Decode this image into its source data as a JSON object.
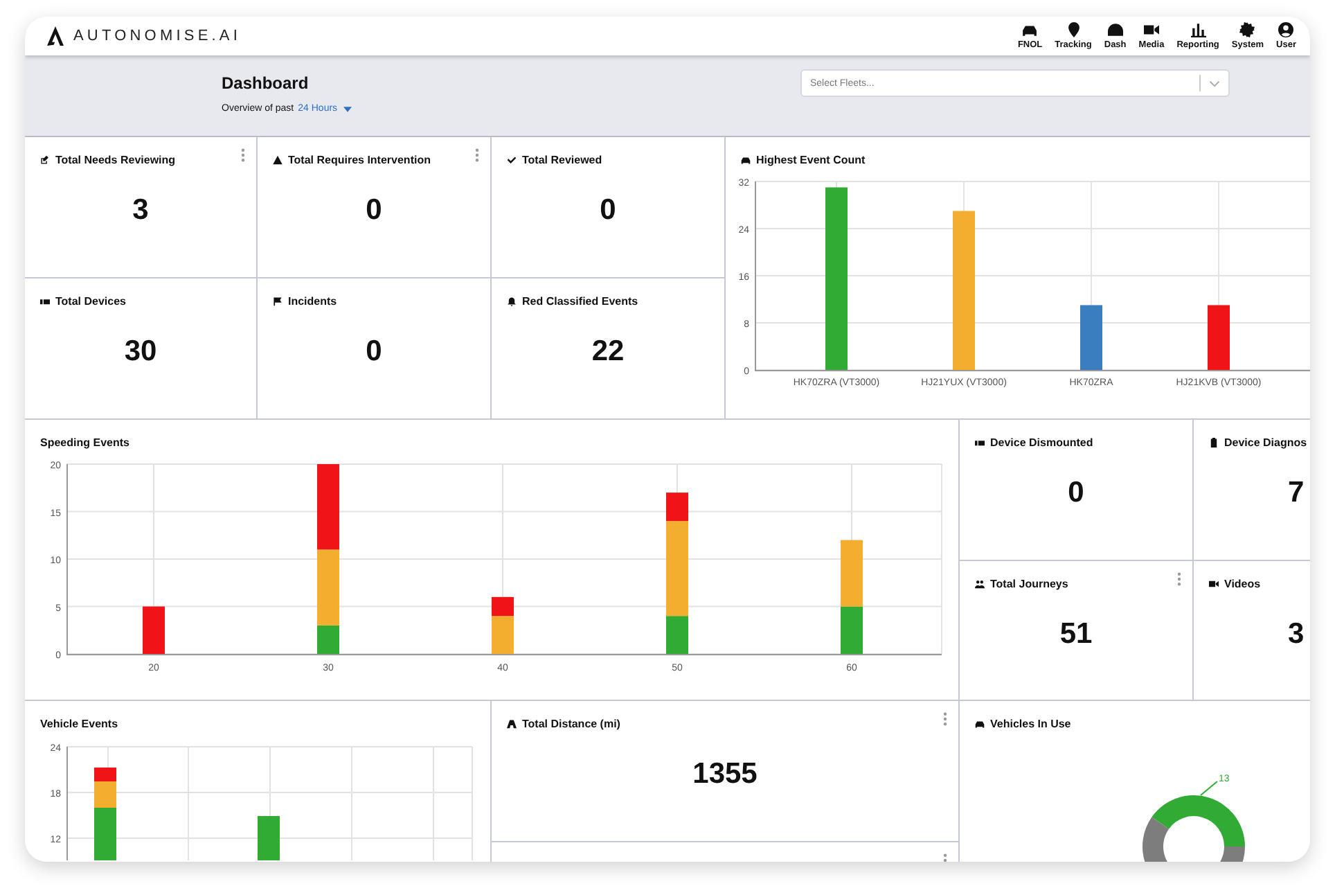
{
  "header": {
    "logo_text": "AUTONOMISE.AI",
    "nav": [
      {
        "label": "FNOL"
      },
      {
        "label": "Tracking"
      },
      {
        "label": "Dash"
      },
      {
        "label": "Media"
      },
      {
        "label": "Reporting"
      },
      {
        "label": "System"
      },
      {
        "label": "User"
      }
    ]
  },
  "page": {
    "title": "Dashboard",
    "overview_label": "Overview of past",
    "period": "24 Hours",
    "fleet_select": {
      "placeholder": "Select Fleets..."
    }
  },
  "stat_cards_top": [
    {
      "title": "Total Needs Reviewing",
      "value": "3",
      "has_menu": true
    },
    {
      "title": "Total Requires Intervention",
      "value": "0",
      "has_menu": true
    },
    {
      "title": "Total Reviewed",
      "value": "0",
      "has_menu": false
    },
    {
      "title": "Total Devices",
      "value": "30",
      "has_menu": false
    },
    {
      "title": "Incidents",
      "value": "0",
      "has_menu": false
    },
    {
      "title": "Red Classified Events",
      "value": "22",
      "has_menu": false
    }
  ],
  "highest_event_count": {
    "title": "Highest Event Count",
    "chart_data": {
      "type": "bar",
      "categories": [
        "HK70ZRA (VT3000)",
        "HJ21YUX (VT3000)",
        "HK70ZRA",
        "HJ21KVB (VT3000)"
      ],
      "values": [
        31,
        27,
        11,
        11
      ],
      "ylim": [
        0,
        32
      ],
      "yticks": [
        0,
        8,
        16,
        24,
        32
      ],
      "grid": true
    }
  },
  "speeding_events": {
    "title": "Speeding Events",
    "chart_data": {
      "type": "bar",
      "stacked": true,
      "categories": [
        "20",
        "30",
        "40",
        "50",
        "60"
      ],
      "series": [
        {
          "color": "#31ab33",
          "values": [
            0,
            3,
            0,
            4,
            5
          ]
        },
        {
          "color": "#f4ae2f",
          "values": [
            0,
            8,
            4,
            10,
            7
          ]
        },
        {
          "color": "#f01419",
          "values": [
            5,
            9,
            2,
            3,
            0
          ]
        }
      ],
      "ylim": [
        0,
        20
      ],
      "yticks": [
        0,
        5,
        10,
        15,
        20
      ],
      "grid": true
    }
  },
  "stat_cards_right": [
    {
      "title": "Device Dismounted",
      "value": "0",
      "has_menu": false
    },
    {
      "title": "Device Diagnos",
      "value": "7",
      "has_menu": false
    },
    {
      "title": "Total Journeys",
      "value": "51",
      "has_menu": true
    },
    {
      "title": "Videos",
      "value": "3",
      "has_menu": false
    }
  ],
  "vehicle_events": {
    "title": "Vehicle Events",
    "y_tick_labels": [
      "24",
      "18",
      "12"
    ]
  },
  "total_distance": {
    "title": "Total Distance (mi)",
    "value": "1355",
    "has_menu": true
  },
  "lower_card": {
    "has_menu": true
  },
  "vehicles_in_use": {
    "title": "Vehicles In Use",
    "donut_label": "13"
  }
}
